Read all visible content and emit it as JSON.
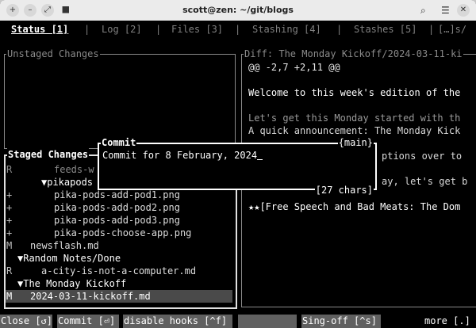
{
  "window": {
    "title": "scott@zen: ~/git/blogs",
    "icons": [
      "new-tab-icon",
      "minimize-icon",
      "resize-icon",
      "pin-icon",
      "search-icon",
      "menu-icon",
      "close-icon"
    ]
  },
  "tabs": [
    {
      "label": "Status [1]",
      "active": true
    },
    {
      "label": "Log [2]",
      "active": false
    },
    {
      "label": "Files [3]",
      "active": false
    },
    {
      "label": "Stashing [4]",
      "active": false
    },
    {
      "label": "Stashes [5]",
      "active": false
    },
    {
      "label": "[…]s/",
      "active": false
    }
  ],
  "unstaged": {
    "title": "Unstaged Changes"
  },
  "diff": {
    "title": "Diff: The Monday Kickoff/2024-03-11-ki",
    "lines": [
      "@@ -2,7 +2,11 @@",
      "",
      "Welcome to this week's edition of the",
      "",
      "Let's get this Monday started with th",
      "A quick announcement: The Monday Kick",
      "",
      "ptions over to",
      "",
      "ay, let's get b",
      "",
      "★★[Free Speech and Bad Meats: The Dom"
    ]
  },
  "staged": {
    "title": "Staged Changes",
    "items": [
      {
        "status": "R",
        "name": "feeds-w"
      },
      {
        "status": "",
        "name": "▼pikapods"
      },
      {
        "status": "+",
        "name": "pika-pods-add-pod1.png"
      },
      {
        "status": "+",
        "name": "pika-pods-add-pod2.png"
      },
      {
        "status": "+",
        "name": "pika-pods-add-pod3.png"
      },
      {
        "status": "+",
        "name": "pika-pods-choose-app.png"
      },
      {
        "status": "M",
        "name": "newsflash.md"
      },
      {
        "status": "",
        "name": "▼Random Notes/Done"
      },
      {
        "status": "R",
        "name": "a-city-is-not-a-computer.md"
      },
      {
        "status": "",
        "name": "▼The Monday Kickoff"
      },
      {
        "status": "M",
        "name": "2024-03-11-kickoff.md"
      }
    ]
  },
  "commit_modal": {
    "title": "Commit",
    "branch": "{main}",
    "input": "Commit for 8 February, 2024",
    "chars": "[27 chars]"
  },
  "bottom": {
    "close": "Close [↺]",
    "commit": "Commit [⏎]",
    "disable_hooks": "disable hooks [^f]",
    "signoff": "Sing-off [^s]",
    "more": "more [.]"
  }
}
